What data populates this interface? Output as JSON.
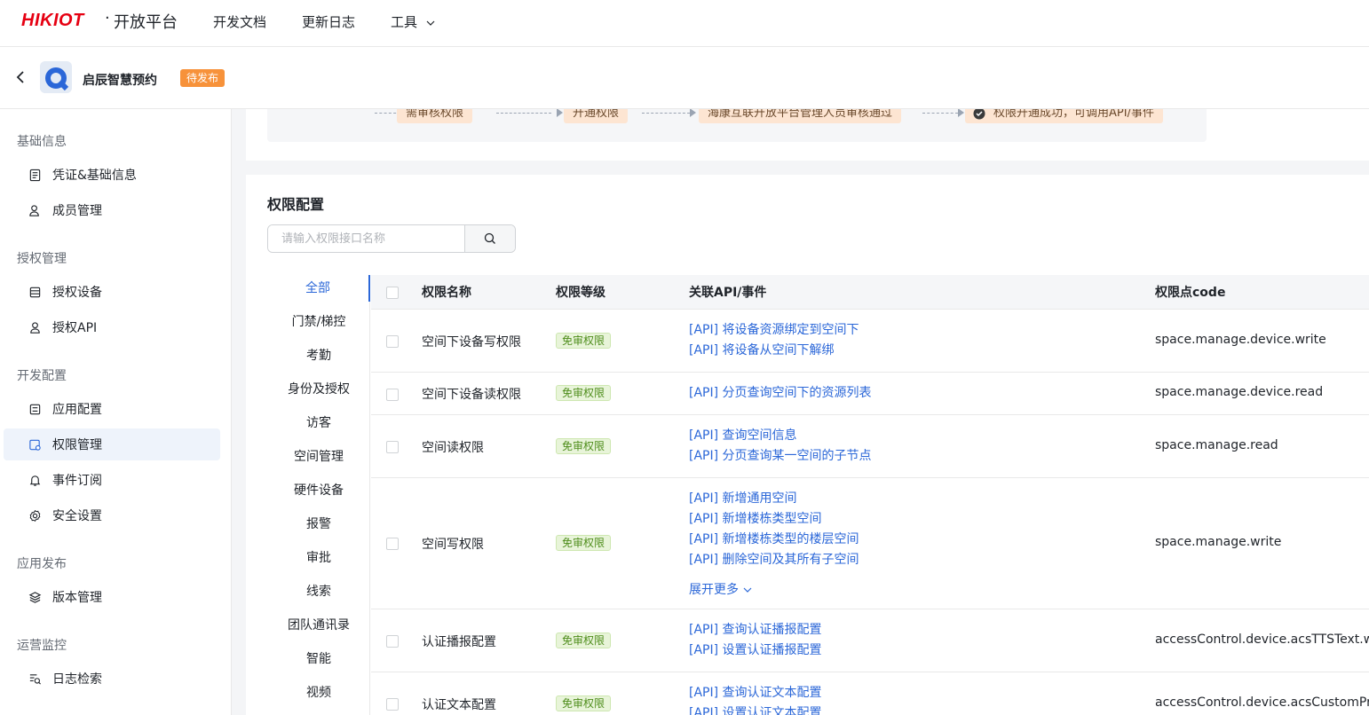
{
  "topnav": {
    "logo": "HIKIOT",
    "logo_dot": "·",
    "platform": "开放平台",
    "links": [
      "开发文档",
      "更新日志",
      "工具"
    ]
  },
  "app": {
    "name": "启辰智慧预约",
    "status": "待发布"
  },
  "sidebar": {
    "groups": [
      {
        "title": "基础信息",
        "items": [
          {
            "label": "凭证&基础信息",
            "icon": "document-icon"
          },
          {
            "label": "成员管理",
            "icon": "members-icon"
          }
        ]
      },
      {
        "title": "授权管理",
        "items": [
          {
            "label": "授权设备",
            "icon": "device-list-icon"
          },
          {
            "label": "授权API",
            "icon": "user-api-icon"
          }
        ]
      },
      {
        "title": "开发配置",
        "items": [
          {
            "label": "应用配置",
            "icon": "app-config-icon"
          },
          {
            "label": "权限管理",
            "icon": "permission-icon"
          },
          {
            "label": "事件订阅",
            "icon": "bell-icon"
          },
          {
            "label": "安全设置",
            "icon": "gear-icon"
          }
        ]
      },
      {
        "title": "应用发布",
        "items": [
          {
            "label": "版本管理",
            "icon": "layers-icon"
          }
        ]
      },
      {
        "title": "运营监控",
        "items": [
          {
            "label": "日志检索",
            "icon": "log-search-icon"
          }
        ]
      }
    ],
    "active": "权限管理"
  },
  "flow": {
    "steps": [
      "需审核权限",
      "开通权限",
      "海康互联开放平台管理人员审核通过",
      "权限开通成功，可调用API/事件"
    ]
  },
  "permission_config": {
    "title": "权限配置",
    "search_placeholder": "请输入权限接口名称",
    "categories": [
      "全部",
      "门禁/梯控",
      "考勤",
      "身份及授权",
      "访客",
      "空间管理",
      "硬件设备",
      "报警",
      "审批",
      "线索",
      "团队通讯录",
      "智能",
      "视频"
    ],
    "active_category": "全部",
    "columns": [
      "权限名称",
      "权限等级",
      "关联API/事件",
      "权限点code"
    ],
    "rows": [
      {
        "name": "空间下设备写权限",
        "level": "免审权限",
        "apis": [
          "[API] 将设备资源绑定到空间下",
          "[API] 将设备从空间下解绑"
        ],
        "code": "space.manage.device.write"
      },
      {
        "name": "空间下设备读权限",
        "level": "免审权限",
        "apis": [
          "[API] 分页查询空间下的资源列表"
        ],
        "code": "space.manage.device.read"
      },
      {
        "name": "空间读权限",
        "level": "免审权限",
        "apis": [
          "[API] 查询空间信息",
          "[API] 分页查询某一空间的子节点"
        ],
        "code": "space.manage.read"
      },
      {
        "name": "空间写权限",
        "level": "免审权限",
        "apis": [
          "[API] 新增通用空间",
          "[API] 新增楼栋类型空间",
          "[API] 新增楼栋类型的楼层空间",
          "[API] 删除空间及其所有子空间"
        ],
        "more": "展开更多",
        "code": "space.manage.write"
      },
      {
        "name": "认证播报配置",
        "level": "免审权限",
        "apis": [
          "[API] 查询认证播报配置",
          "[API] 设置认证播报配置"
        ],
        "code": "accessControl.device.acsTTSText.write"
      },
      {
        "name": "认证文本配置",
        "level": "免审权限",
        "apis": [
          "[API] 查询认证文本配置",
          "[API] 设置认证文本配置"
        ],
        "code": "accessControl.device.acsCustomPrompt"
      }
    ]
  }
}
